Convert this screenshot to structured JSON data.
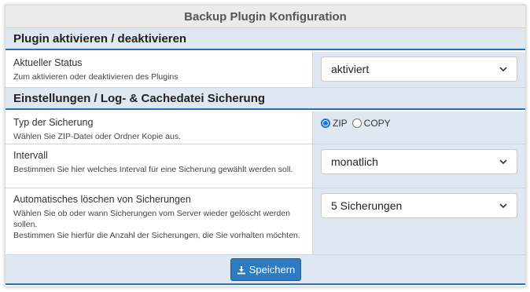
{
  "header": {
    "title": "Backup Plugin Konfiguration"
  },
  "sections": [
    {
      "title": "Plugin aktivieren / deaktivieren"
    },
    {
      "title": "Einstellungen / Log- & Cachedatei Sicherung"
    }
  ],
  "rows": {
    "status": {
      "label": "Aktueller Status",
      "description": "Zum aktivieren oder deaktivieren des Plugins",
      "value": "aktiviert"
    },
    "type": {
      "label": "Typ der Sicherung",
      "description": "Wählen Sie ZIP-Datei oder Ordner Kopie aus.",
      "options": [
        "ZIP",
        "COPY"
      ],
      "selected": "ZIP"
    },
    "interval": {
      "label": "Intervall",
      "description": "Bestimmen Sie hier welches Interval für eine Sicherung gewählt werden soll.",
      "value": "monatlich"
    },
    "autodelete": {
      "label": "Automatisches löschen von Sicherungen",
      "description_1": "Wählen Sie ob oder wann Sicherungen vom Server wieder gelöscht werden sollen.",
      "description_2": "Bestimmen Sie hierfür die Anzahl der Sicherungen, die Sie vorhalten möchten.",
      "value": "5 Sicherungen"
    }
  },
  "footer": {
    "save_label": "Speichern",
    "save_icon": "download-icon"
  },
  "colors": {
    "accent": "#2a6fb4",
    "button": "#2f7bbf",
    "section_bg": "#dfe8f1"
  }
}
